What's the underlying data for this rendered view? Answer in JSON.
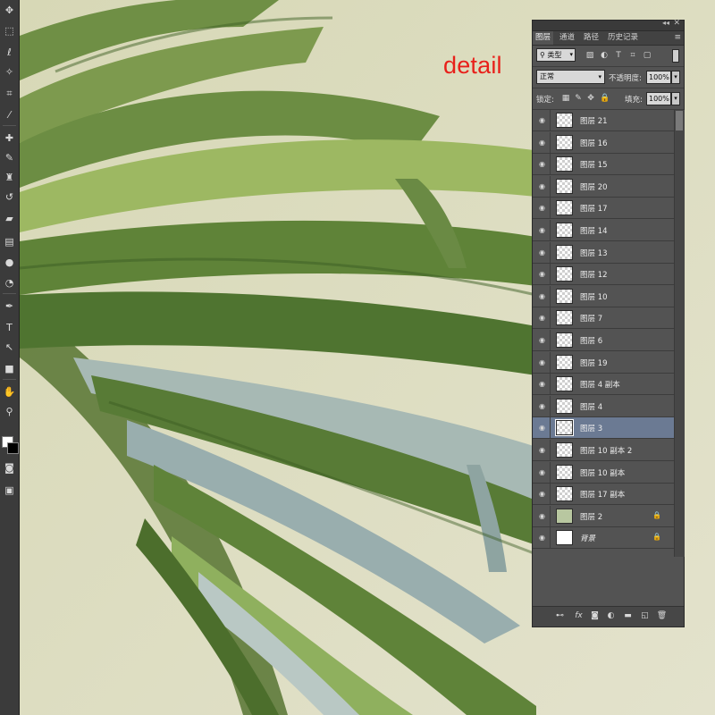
{
  "canvas": {
    "overlay_text": "detail",
    "overlay_color": "#e8201a",
    "background_color": "#dcdcc0"
  },
  "toolbox": {
    "tools": [
      {
        "name": "move-tool-icon",
        "glyph": "✥"
      },
      {
        "name": "marquee-tool-icon",
        "glyph": "⬚"
      },
      {
        "name": "lasso-tool-icon",
        "glyph": "ℓ"
      },
      {
        "name": "magic-wand-tool-icon",
        "glyph": "✧"
      },
      {
        "name": "crop-tool-icon",
        "glyph": "⌗"
      },
      {
        "name": "eyedropper-tool-icon",
        "glyph": "⁄"
      },
      {
        "name": "healing-brush-tool-icon",
        "glyph": "✚"
      },
      {
        "name": "brush-tool-icon",
        "glyph": "✎"
      },
      {
        "name": "clone-stamp-tool-icon",
        "glyph": "♜"
      },
      {
        "name": "history-brush-tool-icon",
        "glyph": "↺"
      },
      {
        "name": "eraser-tool-icon",
        "glyph": "▰"
      },
      {
        "name": "gradient-tool-icon",
        "glyph": "▤"
      },
      {
        "name": "blur-tool-icon",
        "glyph": "●"
      },
      {
        "name": "dodge-tool-icon",
        "glyph": "◔"
      },
      {
        "name": "pen-tool-icon",
        "glyph": "✒"
      },
      {
        "name": "type-tool-icon",
        "glyph": "T"
      },
      {
        "name": "path-selection-tool-icon",
        "glyph": "↖"
      },
      {
        "name": "shape-tool-icon",
        "glyph": "■"
      },
      {
        "name": "hand-tool-icon",
        "glyph": "✋"
      },
      {
        "name": "zoom-tool-icon",
        "glyph": "⚲"
      }
    ]
  },
  "layers_panel": {
    "tabs": [
      {
        "label": "图层",
        "active": true
      },
      {
        "label": "通道",
        "active": false
      },
      {
        "label": "路径",
        "active": false
      },
      {
        "label": "历史记录",
        "active": false
      }
    ],
    "filter": {
      "label": "类型"
    },
    "blend_mode": "正常",
    "opacity_label": "不透明度:",
    "opacity_value": "100%",
    "lock_label": "锁定:",
    "fill_label": "填充:",
    "fill_value": "100%",
    "layers": [
      {
        "name": "图层 21",
        "thumb": "checker",
        "selected": false,
        "locked": false,
        "italic": false
      },
      {
        "name": "图层 16",
        "thumb": "checker",
        "selected": false,
        "locked": false,
        "italic": false
      },
      {
        "name": "图层 15",
        "thumb": "checker",
        "selected": false,
        "locked": false,
        "italic": false
      },
      {
        "name": "图层 20",
        "thumb": "checker",
        "selected": false,
        "locked": false,
        "italic": false
      },
      {
        "name": "图层 17",
        "thumb": "checker",
        "selected": false,
        "locked": false,
        "italic": false
      },
      {
        "name": "图层 14",
        "thumb": "checker",
        "selected": false,
        "locked": false,
        "italic": false
      },
      {
        "name": "图层 13",
        "thumb": "checker",
        "selected": false,
        "locked": false,
        "italic": false
      },
      {
        "name": "图层 12",
        "thumb": "checker",
        "selected": false,
        "locked": false,
        "italic": false
      },
      {
        "name": "图层 10",
        "thumb": "checker",
        "selected": false,
        "locked": false,
        "italic": false
      },
      {
        "name": "图层 7",
        "thumb": "checker",
        "selected": false,
        "locked": false,
        "italic": false
      },
      {
        "name": "图层 6",
        "thumb": "checker",
        "selected": false,
        "locked": false,
        "italic": false
      },
      {
        "name": "图层 19",
        "thumb": "checker",
        "selected": false,
        "locked": false,
        "italic": false
      },
      {
        "name": "图层 4 副本",
        "thumb": "checker",
        "selected": false,
        "locked": false,
        "italic": false
      },
      {
        "name": "图层 4",
        "thumb": "checker",
        "selected": false,
        "locked": false,
        "italic": false
      },
      {
        "name": "图层 3",
        "thumb": "checker",
        "selected": true,
        "locked": false,
        "italic": false
      },
      {
        "name": "图层 10 副本 2",
        "thumb": "checker",
        "selected": false,
        "locked": false,
        "italic": false
      },
      {
        "name": "图层 10 副本",
        "thumb": "checker",
        "selected": false,
        "locked": false,
        "italic": false
      },
      {
        "name": "图层 17 副本",
        "thumb": "checker",
        "selected": false,
        "locked": false,
        "italic": false
      },
      {
        "name": "图层 2",
        "thumb": "art",
        "selected": false,
        "locked": true,
        "italic": false
      },
      {
        "name": "背景",
        "thumb": "white",
        "selected": false,
        "locked": true,
        "italic": true
      }
    ],
    "bottom_icons": [
      "link-layers-icon",
      "fx-icon",
      "add-mask-icon",
      "adjustment-layer-icon",
      "new-group-icon",
      "new-layer-icon",
      "delete-layer-icon"
    ]
  }
}
